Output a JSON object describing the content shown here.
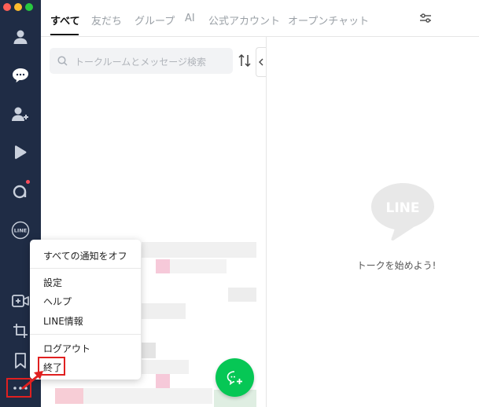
{
  "window": {
    "traffic_lights": [
      "#ff5f57",
      "#febc2e",
      "#28c840"
    ]
  },
  "sidebar": {
    "background": "#1f2c45",
    "items": [
      {
        "icon": "person-icon"
      },
      {
        "icon": "chat-icon"
      },
      {
        "icon": "add-friend-icon"
      },
      {
        "icon": "play-icon"
      },
      {
        "icon": "openchat-icon"
      },
      {
        "icon": "line-icon"
      },
      {
        "icon": "video-call-icon"
      },
      {
        "icon": "crop-icon"
      },
      {
        "icon": "bookmark-icon"
      },
      {
        "icon": "more-icon"
      }
    ]
  },
  "tabs": [
    {
      "label": "すべて",
      "active": true
    },
    {
      "label": "友だち"
    },
    {
      "label": "グループ"
    },
    {
      "label": "AI"
    },
    {
      "label": "公式アカウント"
    },
    {
      "label": "オープンチャット"
    }
  ],
  "search": {
    "placeholder": "トークルームとメッセージ検索",
    "value": ""
  },
  "empty_state": {
    "logo_text": "LINE",
    "message": "トークを始めよう!"
  },
  "menu": {
    "items": [
      {
        "label": "すべての通知をオフ"
      },
      {
        "label": "設定"
      },
      {
        "label": "ヘルプ"
      },
      {
        "label": "LINE情報"
      },
      {
        "label": "ログアウト"
      },
      {
        "label": "終了",
        "highlighted": true
      }
    ]
  },
  "colors": {
    "accent": "#06c755",
    "annotation": "#e02020"
  }
}
